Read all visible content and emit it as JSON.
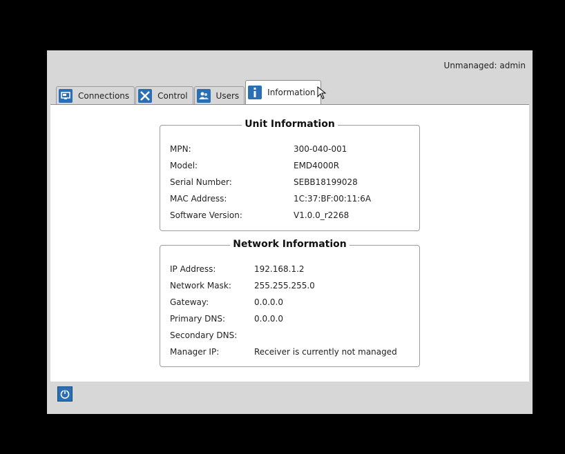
{
  "header": {
    "user_status": "Unmanaged: admin"
  },
  "tabs": [
    {
      "label": "Connections",
      "icon": "monitor-icon",
      "color": "#2a6fb3"
    },
    {
      "label": "Control",
      "icon": "tools-icon",
      "color": "#2a6fb3"
    },
    {
      "label": "Users",
      "icon": "users-icon",
      "color": "#2a6fb3"
    },
    {
      "label": "Information",
      "icon": "info-icon",
      "color": "#2a6fb3",
      "active": true
    }
  ],
  "unit_info": {
    "title": "Unit Information",
    "rows": [
      {
        "label": "MPN:",
        "value": "300-040-001"
      },
      {
        "label": "Model:",
        "value": "EMD4000R"
      },
      {
        "label": "Serial Number:",
        "value": "SEBB18199028"
      },
      {
        "label": "MAC Address:",
        "value": "1C:37:BF:00:11:6A"
      },
      {
        "label": "Software Version:",
        "value": "V1.0.0_r2268"
      }
    ]
  },
  "network_info": {
    "title": "Network Information",
    "rows": [
      {
        "label": "IP Address:",
        "value": "192.168.1.2"
      },
      {
        "label": "Network Mask:",
        "value": "255.255.255.0"
      },
      {
        "label": "Gateway:",
        "value": "0.0.0.0"
      },
      {
        "label": "Primary DNS:",
        "value": "0.0.0.0"
      },
      {
        "label": "Secondary DNS:",
        "value": ""
      },
      {
        "label": "Manager IP:",
        "value": "Receiver is currently not managed"
      }
    ]
  },
  "footer": {
    "power_icon": "power-icon"
  }
}
